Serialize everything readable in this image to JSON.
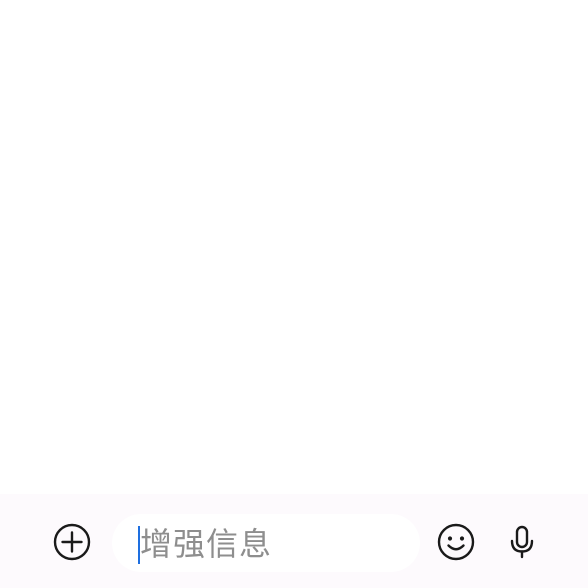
{
  "composer": {
    "placeholder": "增强信息",
    "icons": {
      "add": "add-circle-icon",
      "emoji": "smiley-face-icon",
      "voice": "microphone-icon"
    }
  },
  "colors": {
    "bar_background": "#fdfafd",
    "input_background": "#ffffff",
    "icon_stroke": "#1a1a1a",
    "caret": "#1e6fe0",
    "placeholder": "#8e8e8e"
  }
}
